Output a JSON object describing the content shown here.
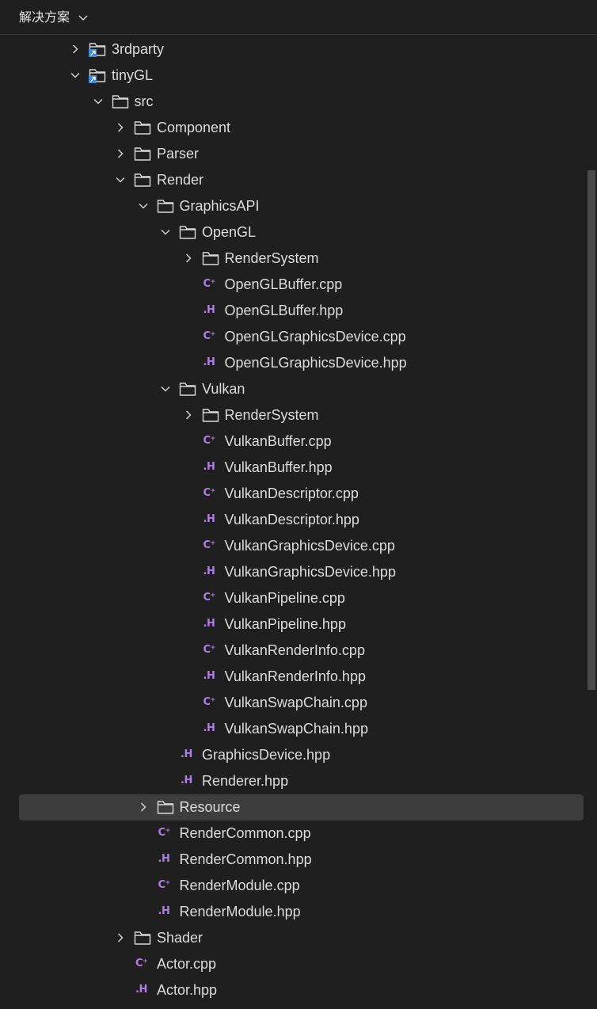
{
  "header": {
    "title": "解决方案"
  },
  "tree": [
    {
      "label": "3rdparty",
      "kind": "project",
      "depth": 0,
      "expandable": true,
      "expanded": false
    },
    {
      "label": "tinyGL",
      "kind": "project",
      "depth": 0,
      "expandable": true,
      "expanded": true
    },
    {
      "label": "src",
      "kind": "folder",
      "depth": 1,
      "expandable": true,
      "expanded": true
    },
    {
      "label": "Component",
      "kind": "folder",
      "depth": 2,
      "expandable": true,
      "expanded": false
    },
    {
      "label": "Parser",
      "kind": "folder",
      "depth": 2,
      "expandable": true,
      "expanded": false
    },
    {
      "label": "Render",
      "kind": "folder",
      "depth": 2,
      "expandable": true,
      "expanded": true
    },
    {
      "label": "GraphicsAPI",
      "kind": "folder",
      "depth": 3,
      "expandable": true,
      "expanded": true
    },
    {
      "label": "OpenGL",
      "kind": "folder",
      "depth": 4,
      "expandable": true,
      "expanded": true
    },
    {
      "label": "RenderSystem",
      "kind": "folder",
      "depth": 5,
      "expandable": true,
      "expanded": false
    },
    {
      "label": "OpenGLBuffer.cpp",
      "kind": "cpp",
      "depth": 5
    },
    {
      "label": "OpenGLBuffer.hpp",
      "kind": "hpp",
      "depth": 5
    },
    {
      "label": "OpenGLGraphicsDevice.cpp",
      "kind": "cpp",
      "depth": 5
    },
    {
      "label": "OpenGLGraphicsDevice.hpp",
      "kind": "hpp",
      "depth": 5
    },
    {
      "label": "Vulkan",
      "kind": "folder",
      "depth": 4,
      "expandable": true,
      "expanded": true
    },
    {
      "label": "RenderSystem",
      "kind": "folder",
      "depth": 5,
      "expandable": true,
      "expanded": false
    },
    {
      "label": "VulkanBuffer.cpp",
      "kind": "cpp",
      "depth": 5
    },
    {
      "label": "VulkanBuffer.hpp",
      "kind": "hpp",
      "depth": 5
    },
    {
      "label": "VulkanDescriptor.cpp",
      "kind": "cpp",
      "depth": 5
    },
    {
      "label": "VulkanDescriptor.hpp",
      "kind": "hpp",
      "depth": 5
    },
    {
      "label": "VulkanGraphicsDevice.cpp",
      "kind": "cpp",
      "depth": 5
    },
    {
      "label": "VulkanGraphicsDevice.hpp",
      "kind": "hpp",
      "depth": 5
    },
    {
      "label": "VulkanPipeline.cpp",
      "kind": "cpp",
      "depth": 5
    },
    {
      "label": "VulkanPipeline.hpp",
      "kind": "hpp",
      "depth": 5
    },
    {
      "label": "VulkanRenderInfo.cpp",
      "kind": "cpp",
      "depth": 5
    },
    {
      "label": "VulkanRenderInfo.hpp",
      "kind": "hpp",
      "depth": 5
    },
    {
      "label": "VulkanSwapChain.cpp",
      "kind": "cpp",
      "depth": 5
    },
    {
      "label": "VulkanSwapChain.hpp",
      "kind": "hpp",
      "depth": 5
    },
    {
      "label": "GraphicsDevice.hpp",
      "kind": "hpp",
      "depth": 4
    },
    {
      "label": "Renderer.hpp",
      "kind": "hpp",
      "depth": 4
    },
    {
      "label": "Resource",
      "kind": "folder",
      "depth": 3,
      "expandable": true,
      "expanded": false,
      "selected": true
    },
    {
      "label": "RenderCommon.cpp",
      "kind": "cpp",
      "depth": 3
    },
    {
      "label": "RenderCommon.hpp",
      "kind": "hpp",
      "depth": 3
    },
    {
      "label": "RenderModule.cpp",
      "kind": "cpp",
      "depth": 3
    },
    {
      "label": "RenderModule.hpp",
      "kind": "hpp",
      "depth": 3
    },
    {
      "label": "Shader",
      "kind": "folder",
      "depth": 2,
      "expandable": true,
      "expanded": false
    },
    {
      "label": "Actor.cpp",
      "kind": "cpp",
      "depth": 2
    },
    {
      "label": "Actor.hpp",
      "kind": "hpp",
      "depth": 2
    }
  ],
  "icons": {
    "cpp_text": "C⁺",
    "hpp_text": ".H"
  },
  "colors": {
    "background": "#1f1f1f",
    "selected_row": "#3d3d3d",
    "file_icon": "#b07ee8",
    "project_badge": "#3c8dde"
  }
}
